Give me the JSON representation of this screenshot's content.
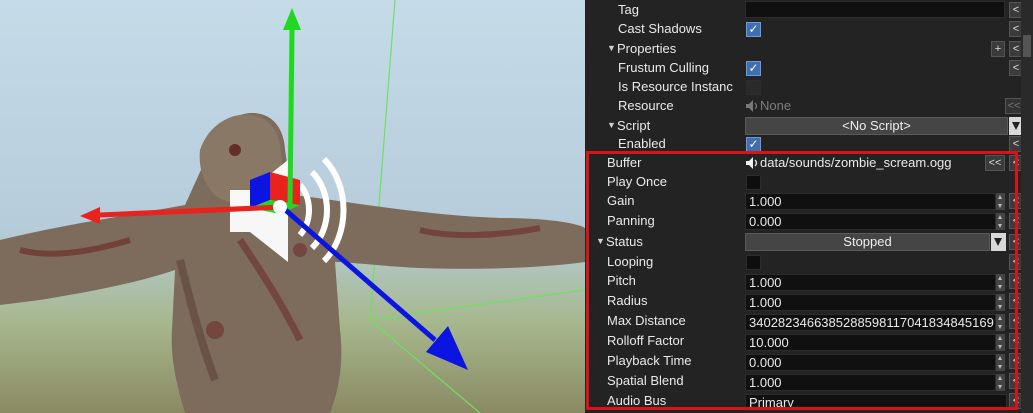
{
  "inspector": {
    "rows": [
      {
        "label": "Tag",
        "value": ""
      },
      {
        "label": "Cast Shadows",
        "checked": true
      },
      {
        "label": "Properties",
        "section": true
      },
      {
        "label": "Frustum Culling",
        "checked": true
      },
      {
        "label": "Is Resource Instanc",
        "checked": false
      },
      {
        "label": "Resource",
        "value": "None"
      },
      {
        "label": "Script",
        "section": true,
        "value": "<No Script>"
      },
      {
        "label": "Enabled",
        "checked": true
      }
    ],
    "buffer": {
      "label": "Buffer",
      "value": "data/sounds/zombie_scream.ogg"
    },
    "play_once": {
      "label": "Play Once",
      "checked": false
    },
    "gain": {
      "label": "Gain",
      "value": "1.000"
    },
    "panning": {
      "label": "Panning",
      "value": "0.000"
    },
    "status": {
      "label": "Status",
      "value": "Stopped"
    },
    "looping": {
      "label": "Looping",
      "checked": false
    },
    "pitch": {
      "label": "Pitch",
      "value": "1.000"
    },
    "radius": {
      "label": "Radius",
      "value": "1.000"
    },
    "max_distance": {
      "label": "Max Distance",
      "value": "3402823466385288598117041834845169"
    },
    "rolloff_factor": {
      "label": "Rolloff Factor",
      "value": "10.000"
    },
    "playback_time": {
      "label": "Playback Time",
      "value": "0.000"
    },
    "spatial_blend": {
      "label": "Spatial Blend",
      "value": "1.000"
    },
    "audio_bus": {
      "label": "Audio Bus",
      "value": "Primary"
    },
    "buttons": {
      "reset": "<",
      "add": "+",
      "more": "<<",
      "checkmark": "✓"
    }
  },
  "colors": {
    "highlight": "#d8141b",
    "gizmo_x": "#e8221c",
    "gizmo_y": "#1fd81f",
    "gizmo_z": "#0b14e0"
  }
}
